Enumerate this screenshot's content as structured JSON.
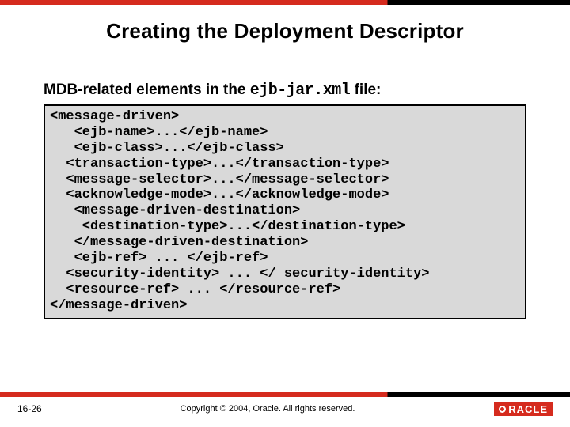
{
  "slide": {
    "title": "Creating the Deployment Descriptor",
    "subtitle_pre": "MDB-related elements in the ",
    "subtitle_code": "ejb-jar.xml",
    "subtitle_post": " file:",
    "code": "<message-driven>\n   <ejb-name>...</ejb-name>\n   <ejb-class>...</ejb-class>\n  <transaction-type>...</transaction-type>\n  <message-selector>...</message-selector>\n  <acknowledge-mode>...</acknowledge-mode>\n   <message-driven-destination>\n    <destination-type>...</destination-type>\n   </message-driven-destination>\n   <ejb-ref> ... </ejb-ref>\n  <security-identity> ... </ security-identity>\n  <resource-ref> ... </resource-ref>\n</message-driven>",
    "slidenum": "16-26",
    "copyright": "Copyright © 2004, Oracle.  All rights reserved.",
    "logo_text": "RACLE"
  }
}
